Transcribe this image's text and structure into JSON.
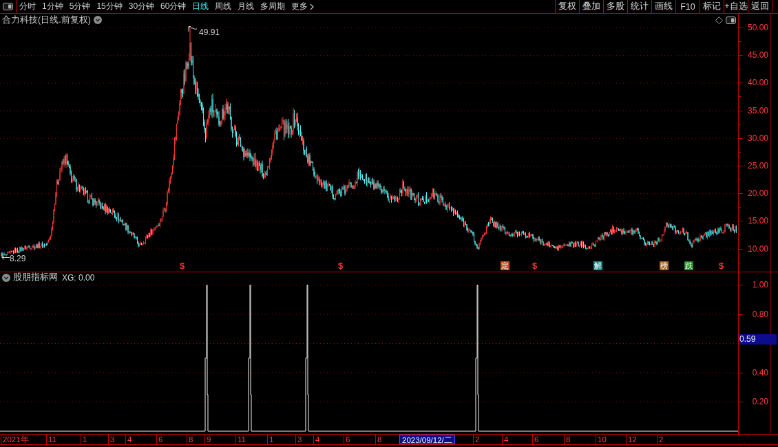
{
  "toolbar": {
    "periods": [
      {
        "label": "分时",
        "selected": false
      },
      {
        "label": "1分钟",
        "selected": false
      },
      {
        "label": "5分钟",
        "selected": false
      },
      {
        "label": "15分钟",
        "selected": false
      },
      {
        "label": "30分钟",
        "selected": false
      },
      {
        "label": "60分钟",
        "selected": false
      },
      {
        "label": "日线",
        "selected": true
      },
      {
        "label": "周线",
        "selected": false
      },
      {
        "label": "月线",
        "selected": false
      },
      {
        "label": "多周期",
        "selected": false
      },
      {
        "label": "更多",
        "selected": false
      }
    ],
    "actions": [
      "复权",
      "叠加",
      "多股",
      "统计",
      "画线",
      "F10",
      "标记",
      "+自选",
      "返回"
    ]
  },
  "price_pane": {
    "title": "合力科技(日线.前复权)",
    "high_label": "49.91",
    "low_label": "8.29",
    "markers": [
      {
        "kind": "sign",
        "label": "$",
        "color": "#ff3434"
      },
      {
        "kind": "sign",
        "label": "$",
        "color": "#ff3434"
      },
      {
        "kind": "tag",
        "label": "定",
        "color": "#c84a1e"
      },
      {
        "kind": "sign",
        "label": "$",
        "color": "#ff3434"
      },
      {
        "kind": "tag",
        "label": "解",
        "color": "#1e8c8c"
      },
      {
        "kind": "tag",
        "label": "榜",
        "color": "#a8641e"
      },
      {
        "kind": "tag",
        "label": "跌",
        "color": "#1e8c28"
      },
      {
        "kind": "sign",
        "label": "$",
        "color": "#ff3434"
      }
    ],
    "y_axis": [
      "50.00",
      "45.00",
      "40.00",
      "35.00",
      "30.00",
      "25.00",
      "20.00",
      "15.00",
      "10.00"
    ]
  },
  "indicator_pane": {
    "title": "股朋指标网",
    "reading": "XG: 0.00",
    "y_axis": [
      "1.00",
      "0.80",
      "0.40",
      "0.20"
    ],
    "cursor_value": "0.59"
  },
  "x_axis": [
    {
      "kind": "tick",
      "label": "2021年"
    },
    {
      "kind": "tick",
      "label": "11"
    },
    {
      "kind": "tick",
      "label": "1"
    },
    {
      "kind": "tick",
      "label": "3"
    },
    {
      "kind": "tick",
      "label": "4"
    },
    {
      "kind": "tick",
      "label": "6"
    },
    {
      "kind": "tick",
      "label": "8"
    },
    {
      "kind": "tick",
      "label": "9"
    },
    {
      "kind": "tick",
      "label": "11"
    },
    {
      "kind": "tick",
      "label": "1"
    },
    {
      "kind": "tick",
      "label": "3"
    },
    {
      "kind": "tick",
      "label": "4"
    },
    {
      "kind": "tick",
      "label": "6"
    },
    {
      "kind": "tick",
      "label": "8"
    },
    {
      "kind": "cursor",
      "label": "2023/09/12/二"
    },
    {
      "kind": "tick",
      "label": "2"
    },
    {
      "kind": "tick",
      "label": "4"
    },
    {
      "kind": "tick",
      "label": "6"
    },
    {
      "kind": "tick",
      "label": "8"
    },
    {
      "kind": "tick",
      "label": "10"
    },
    {
      "kind": "tick",
      "label": "12"
    },
    {
      "kind": "tick",
      "label": "2"
    }
  ]
}
